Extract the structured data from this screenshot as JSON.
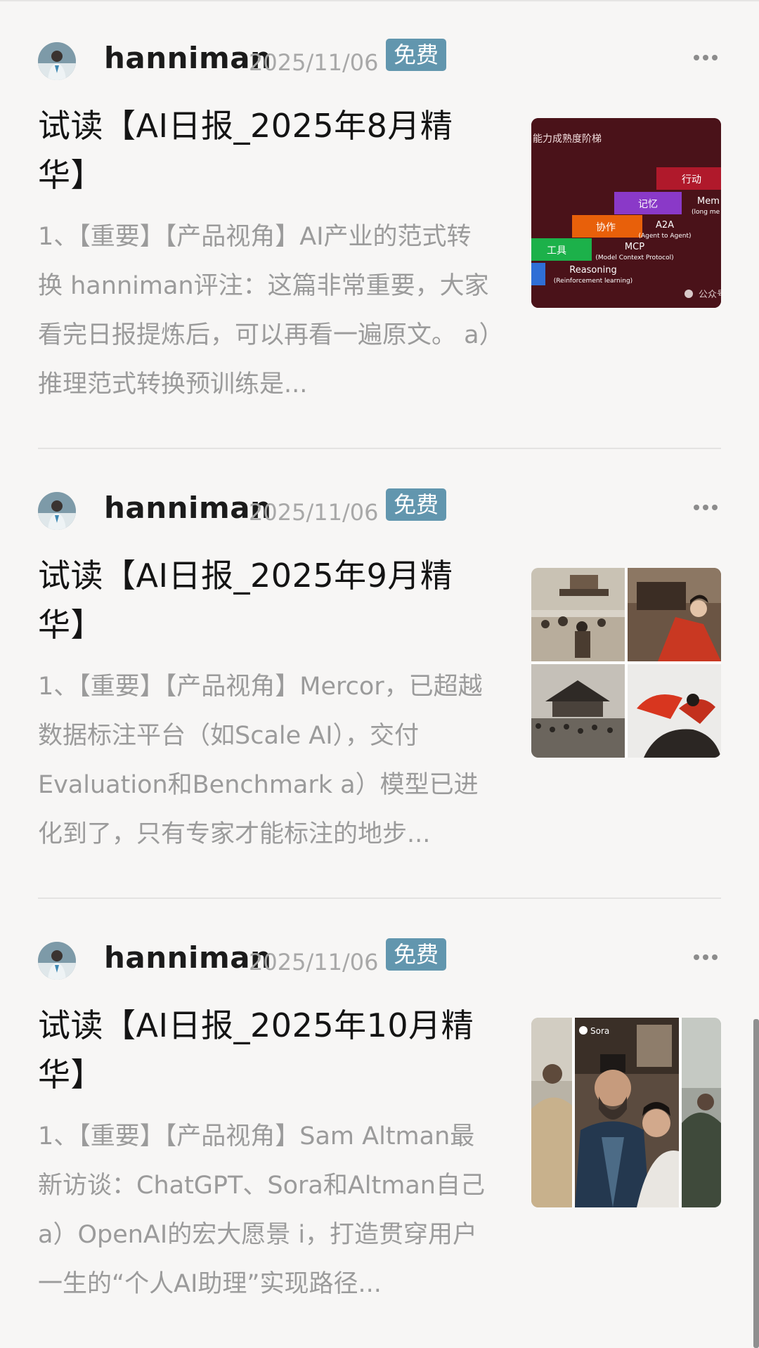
{
  "posts": [
    {
      "author": "hanniman",
      "date": "2025/11/06",
      "badge": "免费",
      "title": "试读【AI日报_2025年8月精华】",
      "summary": "1、【重要】【产品视角】AI产业的范式转换 hanniman评注：这篇非常重要，大家看完日报提炼后，可以再看一遍原文。 a）推理范式转换预训练是...",
      "thumb": {
        "kind": "ladder",
        "heading": "能力成熟度阶梯",
        "steps": [
          {
            "label": "行动",
            "color": "#b0192b"
          },
          {
            "label": "记忆",
            "color": "#8a39c8"
          },
          {
            "label": "协作",
            "color": "#e8600a"
          },
          {
            "label": "工具",
            "color": "#1cb14a"
          }
        ],
        "captions": [
          {
            "main": "Mem",
            "sub": "(long me"
          },
          {
            "main": "A2A",
            "sub": "(Agent to Agent)"
          },
          {
            "main": "MCP",
            "sub": "(Model Context Protocol)"
          },
          {
            "main": "Reasoning",
            "sub": "(Reinforcement learning)"
          }
        ],
        "watermark": "公众号",
        "background": "#4a1219"
      }
    },
    {
      "author": "hanniman",
      "date": "2025/11/06",
      "badge": "免费",
      "title": "试读【AI日报_2025年9月精华】",
      "summary": "1、【重要】【产品视角】Mercor，已超越数据标注平台（如Scale AI），交付Evaluation和Benchmark a）模型已进化到了，只有专家才能标注的地步...",
      "thumb": {
        "kind": "grid"
      }
    },
    {
      "author": "hanniman",
      "date": "2025/11/06",
      "badge": "免费",
      "title": "试读【AI日报_2025年10月精华】",
      "summary": "1、【重要】【产品视角】Sam Altman最新访谈：ChatGPT、Sora和Altman自己 a）OpenAI的宏大愿景 i，打造贯穿用户一生的“个人AI助理”实现路径...",
      "thumb": {
        "kind": "strip",
        "tag": "Sora"
      }
    }
  ],
  "icons": {
    "more": "more-horizontal-icon",
    "avatar": "user-avatar"
  },
  "colors": {
    "badge": "#6296ae",
    "author": "#1b1b1b",
    "date": "#a8a8a8",
    "summary": "#9b9b9b",
    "background": "#f7f6f5"
  }
}
